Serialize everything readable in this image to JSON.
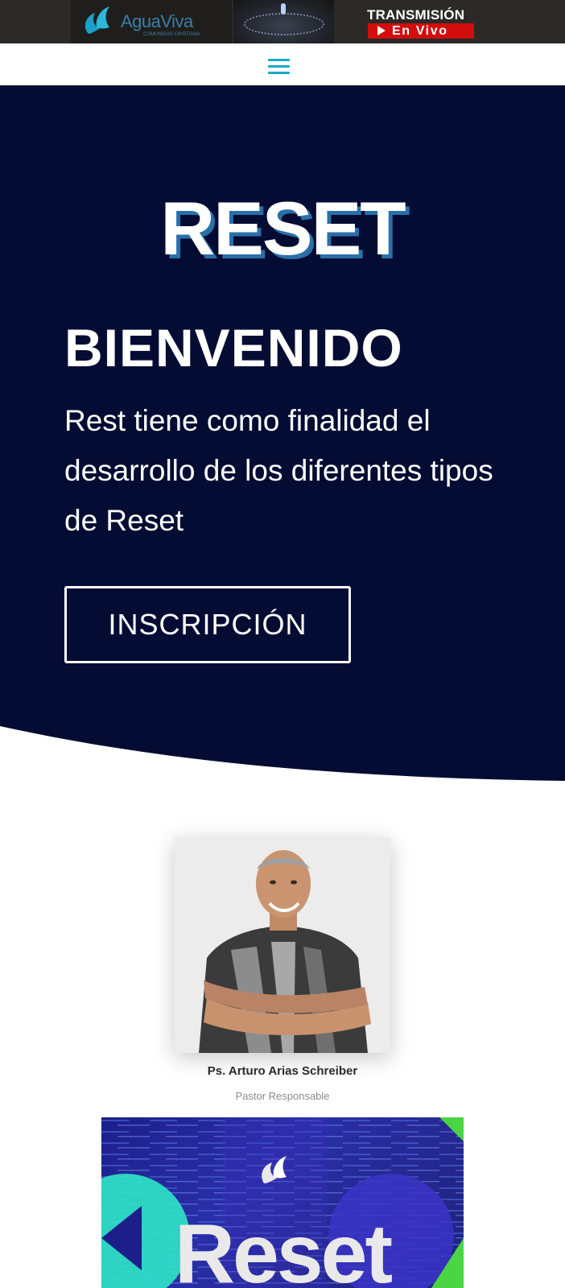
{
  "banner": {
    "logo_text": "AguaViva",
    "logo_subtext": "COMUNIDAD CRISTIANA",
    "live_title": "TRANSMISIÓN",
    "live_label": "En Vivo"
  },
  "nav": {
    "menu_icon": "hamburger-menu-icon"
  },
  "hero": {
    "logo": "RESET",
    "heading": "BIENVENIDO",
    "description": "Rest tiene como finalidad el desarrollo de los diferentes tipos de Reset",
    "cta_label": "INSCRIPCIÓN",
    "background_color": "#050c33"
  },
  "pastor": {
    "name": "Ps. Arturo Arias Schreiber",
    "role": "Pastor Responsable"
  },
  "poster": {
    "title": "Reset",
    "icon": "aguaviva-logo-icon"
  },
  "colors": {
    "accent": "#1aa9c9",
    "live_red": "#d20d0d",
    "poster_teal": "#2ee6c6",
    "poster_green": "#4bd443"
  }
}
